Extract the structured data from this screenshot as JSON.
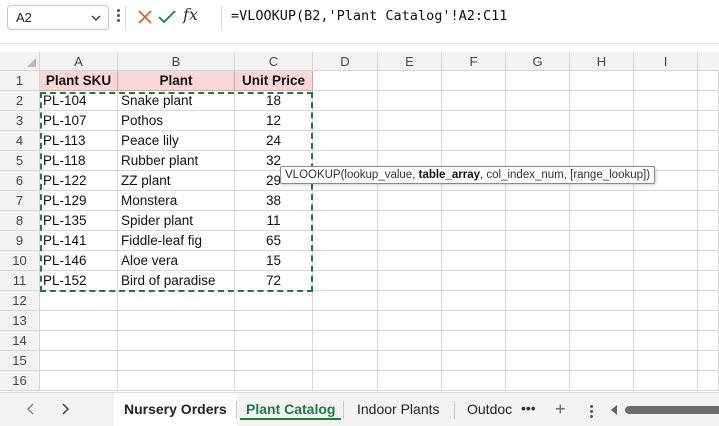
{
  "formula_bar": {
    "name_box": "A2",
    "formula": "=VLOOKUP(B2,'Plant Catalog'!A2:C11"
  },
  "columns": [
    "A",
    "B",
    "C",
    "D",
    "E",
    "F",
    "G",
    "H",
    "I"
  ],
  "rows": [
    "1",
    "2",
    "3",
    "4",
    "5",
    "6",
    "7",
    "8",
    "9",
    "10",
    "11",
    "12",
    "13",
    "14",
    "15",
    "16"
  ],
  "table": {
    "headers": [
      "Plant SKU",
      "Plant",
      "Unit Price"
    ],
    "rows": [
      [
        "PL-104",
        "Snake plant",
        "18"
      ],
      [
        "PL-107",
        "Pothos",
        "12"
      ],
      [
        "PL-113",
        "Peace lily",
        "24"
      ],
      [
        "PL-118",
        "Rubber plant",
        "32"
      ],
      [
        "PL-122",
        "ZZ plant",
        "29"
      ],
      [
        "PL-129",
        "Monstera",
        "38"
      ],
      [
        "PL-135",
        "Spider plant",
        "11"
      ],
      [
        "PL-141",
        "Fiddle-leaf fig",
        "65"
      ],
      [
        "PL-146",
        "Aloe vera",
        "15"
      ],
      [
        "PL-152",
        "Bird of paradise",
        "72"
      ]
    ]
  },
  "tooltip": {
    "prefix": "VLOOKUP(lookup_value, ",
    "bold": "table_array",
    "suffix": ", col_index_num, [range_lookup])"
  },
  "tabs": [
    "Nursery Orders",
    "Plant Catalog",
    "Indoor Plants",
    "Outdoc"
  ],
  "colors": {
    "accent": "#1f7a46",
    "header_fill": "#f8d7d6"
  },
  "icons": {
    "name_box_dropdown": "chevron-down-icon",
    "cancel": "close-icon",
    "confirm": "check-icon",
    "function": "fx-icon",
    "prev": "chevron-left-icon",
    "next": "chevron-right-icon",
    "add_sheet": "plus-icon"
  }
}
